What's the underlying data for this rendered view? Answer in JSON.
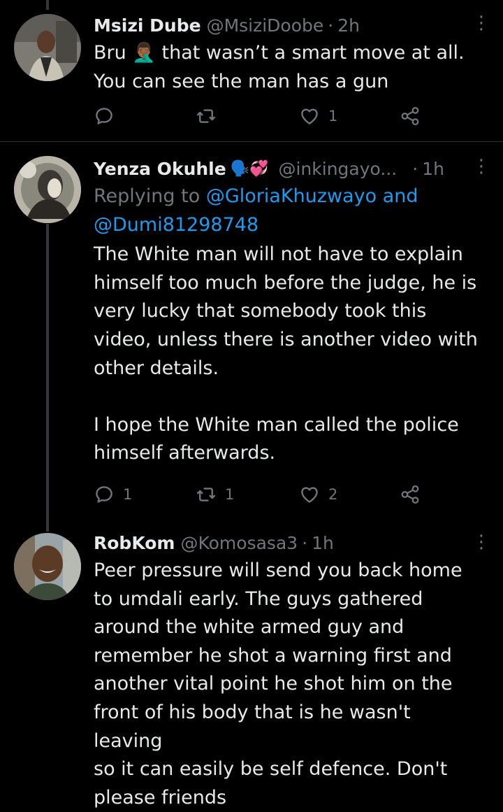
{
  "tweets": [
    {
      "name": "Msizi Dube",
      "emoji": "🙎🏾‍♂️",
      "handle": "@MsiziDoobe",
      "time": "2h",
      "lines": [
        "Bru 🤦🏾‍♂️ that wasn’t a smart move at all.",
        "You can see the man has a gun"
      ],
      "reply_count": "",
      "retweet_count": "",
      "like_count": "1"
    },
    {
      "name": "Yenza Okuhle",
      "emoji": "🗣️💞",
      "handle": "@inkingayo...",
      "time": "1h",
      "replying_prefix": "Replying to",
      "replying_users": "@GloriaKhuzwayo and",
      "replying_users2": "@Dumi81298748",
      "body": "The White man will not have to explain\nhimself too much before the judge, he is\nvery lucky that somebody took this\nvideo, unless there is another video with\nother details.\n\nI hope the White man called the police\nhimself afterwards.",
      "reply_count": "1",
      "retweet_count": "1",
      "like_count": "2"
    },
    {
      "name": "RobKom",
      "handle": "@Komosasa3",
      "time": "1h",
      "body": "Peer pressure will send you back home\nto umdali early. The guys gathered\naround the white armed guy and\nremember he shot a warning first and\nanother vital point he shot him on the\nfront of his body that is he wasn't leaving\nso it can easily be self defence. Don't\nplease friends"
    }
  ],
  "separator": "·",
  "more_glyph": "⋮",
  "colors": {
    "background": "#000000",
    "text": "#e7e9ea",
    "muted": "#71767b",
    "link": "#1d9bf0",
    "border": "#2f3336"
  }
}
